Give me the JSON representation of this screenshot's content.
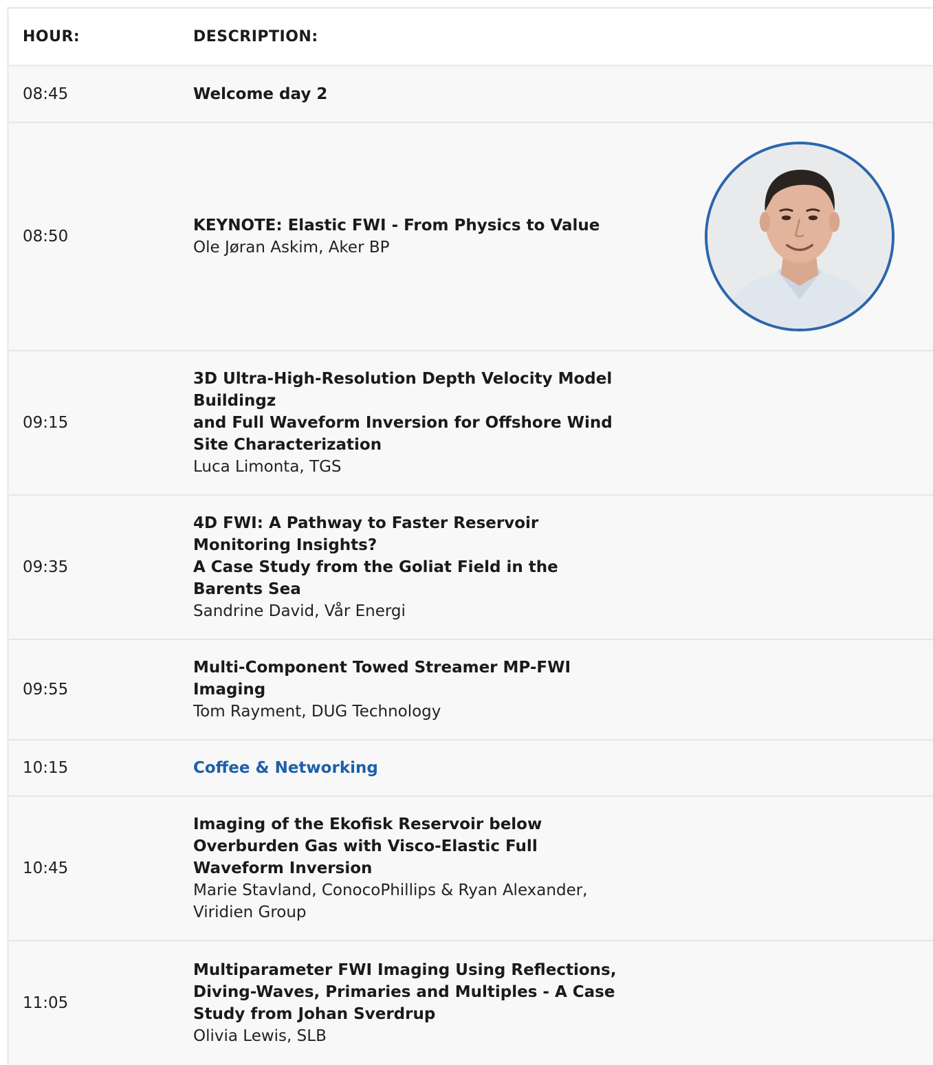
{
  "header": {
    "hour_label": "HOUR:",
    "description_label": "DESCRIPTION:"
  },
  "rows": [
    {
      "time": "08:45",
      "title_lines": [
        "Welcome day 2"
      ],
      "speaker": ""
    },
    {
      "time": "08:50",
      "title_lines": [
        "KEYNOTE: Elastic FWI - From Physics to Value"
      ],
      "speaker": "Ole Jøran Askim, Aker BP",
      "photo": "speaker-portrait"
    },
    {
      "time": "09:15",
      "title_lines": [
        "3D Ultra-High-Resolution Depth Velocity Model Buildingz",
        "and Full Waveform Inversion for Offshore Wind Site Characterization"
      ],
      "speaker": "Luca Limonta, TGS"
    },
    {
      "time": "09:35",
      "title_lines": [
        "4D FWI: A Pathway to Faster Reservoir Monitoring Insights?",
        "A Case Study from the Goliat Field in the Barents Sea"
      ],
      "speaker": "Sandrine David, Vår Energi"
    },
    {
      "time": "09:55",
      "title_lines": [
        "Multi-Component Towed Streamer MP-FWI Imaging"
      ],
      "speaker": "Tom Rayment, DUG Technology"
    },
    {
      "time": "10:15",
      "title_lines": [
        "Coffee & Networking"
      ],
      "speaker": "",
      "accent": "#1f5fa6"
    },
    {
      "time": "10:45",
      "title_lines": [
        "Imaging of the Ekofisk Reservoir below Overburden Gas with Visco-Elastic Full Waveform Inversion"
      ],
      "speaker": "Marie Stavland, ConocoPhillips & Ryan Alexander, Viridien Group"
    },
    {
      "time": "11:05",
      "title_lines": [
        "Multiparameter FWI Imaging Using Reflections, Diving-Waves, Primaries and Multiples - A Case Study from Johan Sverdrup"
      ],
      "speaker": "Olivia Lewis, SLB"
    }
  ]
}
